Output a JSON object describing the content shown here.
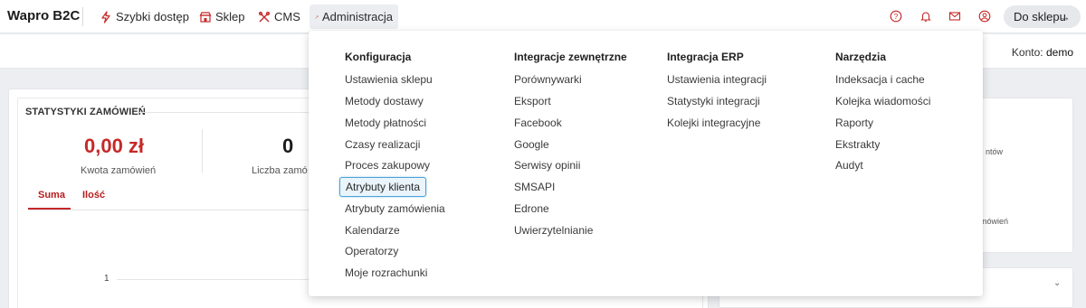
{
  "brand": "Wapro B2C",
  "nav": {
    "items": [
      {
        "label": "Szybki dostęp",
        "icon": "lightning-icon"
      },
      {
        "label": "Sklep",
        "icon": "store-icon"
      },
      {
        "label": "CMS",
        "icon": "tools-icon"
      },
      {
        "label": "Administracja",
        "icon": "wrench-icon"
      }
    ],
    "active": "Administracja",
    "shop_button": "Do sklepu",
    "icons": [
      "help-icon",
      "bell-icon",
      "mail-icon",
      "user-icon"
    ]
  },
  "account": {
    "label": "Konto:",
    "value": "demo"
  },
  "dashboard": {
    "stats_title": "STATYSTYKI ZAMÓWIEŃ",
    "amount_value": "0,00 zł",
    "amount_label": "Kwota zamówień",
    "count_value": "0",
    "count_label": "Liczba zamó",
    "tabs": [
      "Suma",
      "Ilość"
    ],
    "y_tick": "1",
    "right_fragments": [
      "ntów",
      "mówień"
    ]
  },
  "menu": {
    "columns": [
      {
        "title": "Konfiguracja",
        "items": [
          "Ustawienia sklepu",
          "Metody dostawy",
          "Metody płatności",
          "Czasy realizacji",
          "Proces zakupowy",
          "Atrybuty klienta",
          "Atrybuty zamówienia",
          "Kalendarze",
          "Operatorzy",
          "Moje rozrachunki"
        ]
      },
      {
        "title": "Integracje zewnętrzne",
        "items": [
          "Porównywarki",
          "Eksport",
          "Facebook",
          "Google",
          "Serwisy opinii",
          "SMSAPI",
          "Edrone",
          "Uwierzytelnianie"
        ]
      },
      {
        "title": "Integracja ERP",
        "items": [
          "Ustawienia integracji",
          "Statystyki integracji",
          "Kolejki integracyjne"
        ]
      },
      {
        "title": "Narzędzia",
        "items": [
          "Indeksacja i cache",
          "Kolejka wiadomości",
          "Raporty",
          "Ekstrakty",
          "Audyt"
        ]
      }
    ],
    "highlighted": "Atrybuty klienta"
  },
  "colors": {
    "accent_red": "#c62828",
    "highlight_blue": "#4ba3d6"
  }
}
